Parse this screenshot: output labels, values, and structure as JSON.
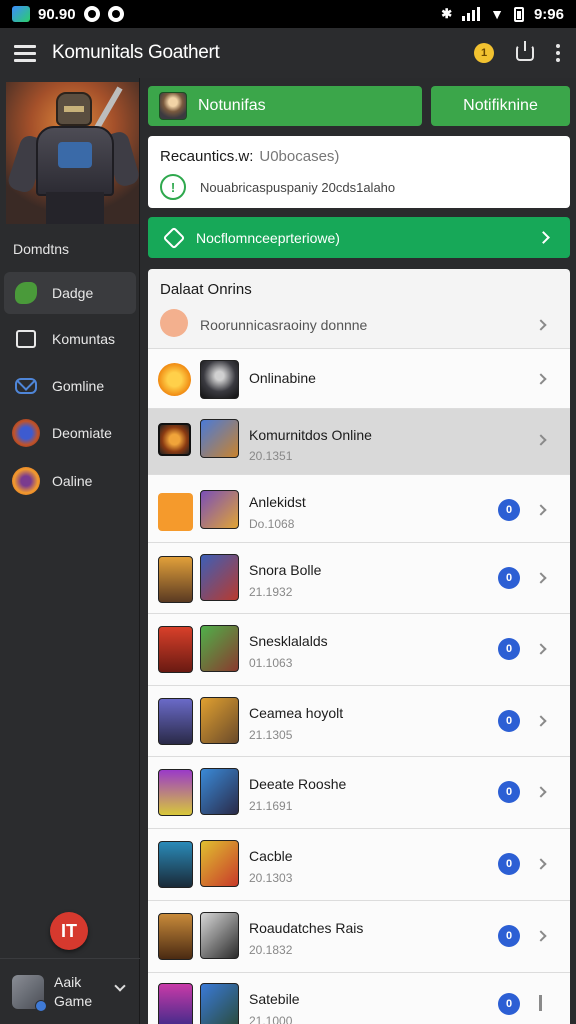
{
  "status_bar": {
    "time_left": "90.90",
    "time_right": "9:96"
  },
  "app_bar": {
    "title": "Komunitals Goathert",
    "coin_label": "1"
  },
  "sidebar": {
    "section_label": "Domdtns",
    "items": [
      {
        "label": "Dadge",
        "icon": "puzzle-icon"
      },
      {
        "label": "Komuntas",
        "icon": "frame-icon"
      },
      {
        "label": "Gomline",
        "icon": "mail-icon"
      },
      {
        "label": "Deomiate",
        "icon": "game-icon"
      },
      {
        "label": "Oaline",
        "icon": "coin-icon"
      }
    ],
    "fab_label": "IT",
    "user": {
      "name": "Aaik",
      "sub": "Game"
    }
  },
  "main": {
    "btn_left_label": "Notunifas",
    "btn_right_label": "Notifiknine",
    "recents": {
      "title": "Recauntics.w:",
      "title_note": "U0bocases)",
      "line": "Nouabricaspuspaniy 20cds1alaho",
      "check_label": "!"
    },
    "banner_label": "Nocflomnceeprteriowe)",
    "list_title": "Dalaat Onrins",
    "rows": [
      {
        "title": "Roorunnicasraoiny donnne"
      },
      {
        "title": "Onlinabine"
      },
      {
        "title": "Komurnitdos Online",
        "sub": "20.1351"
      },
      {
        "title": "Anlekidst",
        "sub": "Do.1068",
        "badge": "0"
      },
      {
        "title": "Snora Bolle",
        "sub": "21.1932",
        "badge": "0"
      },
      {
        "title": "Snesklalalds",
        "sub": "01.1063",
        "badge": "0"
      },
      {
        "title": "Ceamea hoyolt",
        "sub": "21.1305",
        "badge": "0"
      },
      {
        "title": "Deeate Rooshe",
        "sub": "21.1691",
        "badge": "0"
      },
      {
        "title": "Cacble",
        "sub": "20.1303",
        "badge": "0"
      },
      {
        "title": "Roaudatches Rais",
        "sub": "20.1832",
        "badge": "0"
      },
      {
        "title": "Satebile",
        "sub": "21.1000",
        "badge": "0"
      }
    ]
  }
}
